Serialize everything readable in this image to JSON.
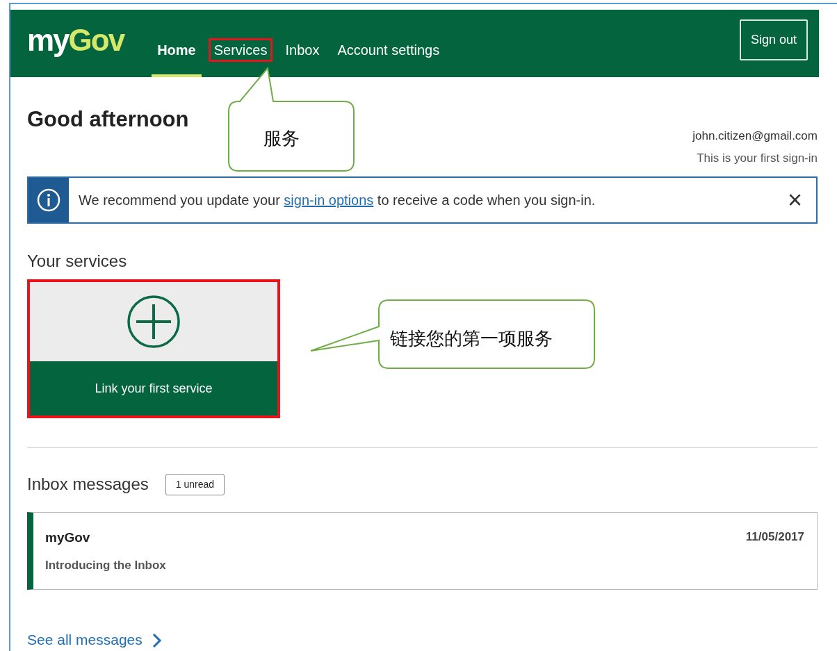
{
  "header": {
    "logo": {
      "part_1": "my",
      "part_2": "Gov"
    },
    "nav": [
      {
        "label": "Home",
        "selected": true,
        "highlighted": false
      },
      {
        "label": "Services",
        "selected": false,
        "highlighted": true
      },
      {
        "label": "Inbox",
        "selected": false,
        "highlighted": false
      },
      {
        "label": "Account settings",
        "selected": false,
        "highlighted": false
      }
    ],
    "sign_out": "Sign out"
  },
  "greeting": "Good afternoon",
  "account": {
    "email": "john.citizen@gmail.com",
    "note": "This is your first sign-in"
  },
  "alert": {
    "text_before": "We recommend you update your ",
    "link": "sign-in options",
    "text_after": " to receive a code when you sign-in.",
    "close": "×"
  },
  "services": {
    "heading": "Your services",
    "tile": {
      "label": "Link your first service",
      "highlighted": true
    }
  },
  "inbox": {
    "heading": "Inbox messages",
    "badge": "1 unread",
    "messages": [
      {
        "sender": "myGov",
        "subject": "Introducing the Inbox",
        "date": "11/05/2017",
        "unread": true
      }
    ],
    "see_all": "See all messages"
  },
  "callouts": [
    {
      "text": "服务"
    },
    {
      "text": "链接您的第一项服务"
    }
  ]
}
